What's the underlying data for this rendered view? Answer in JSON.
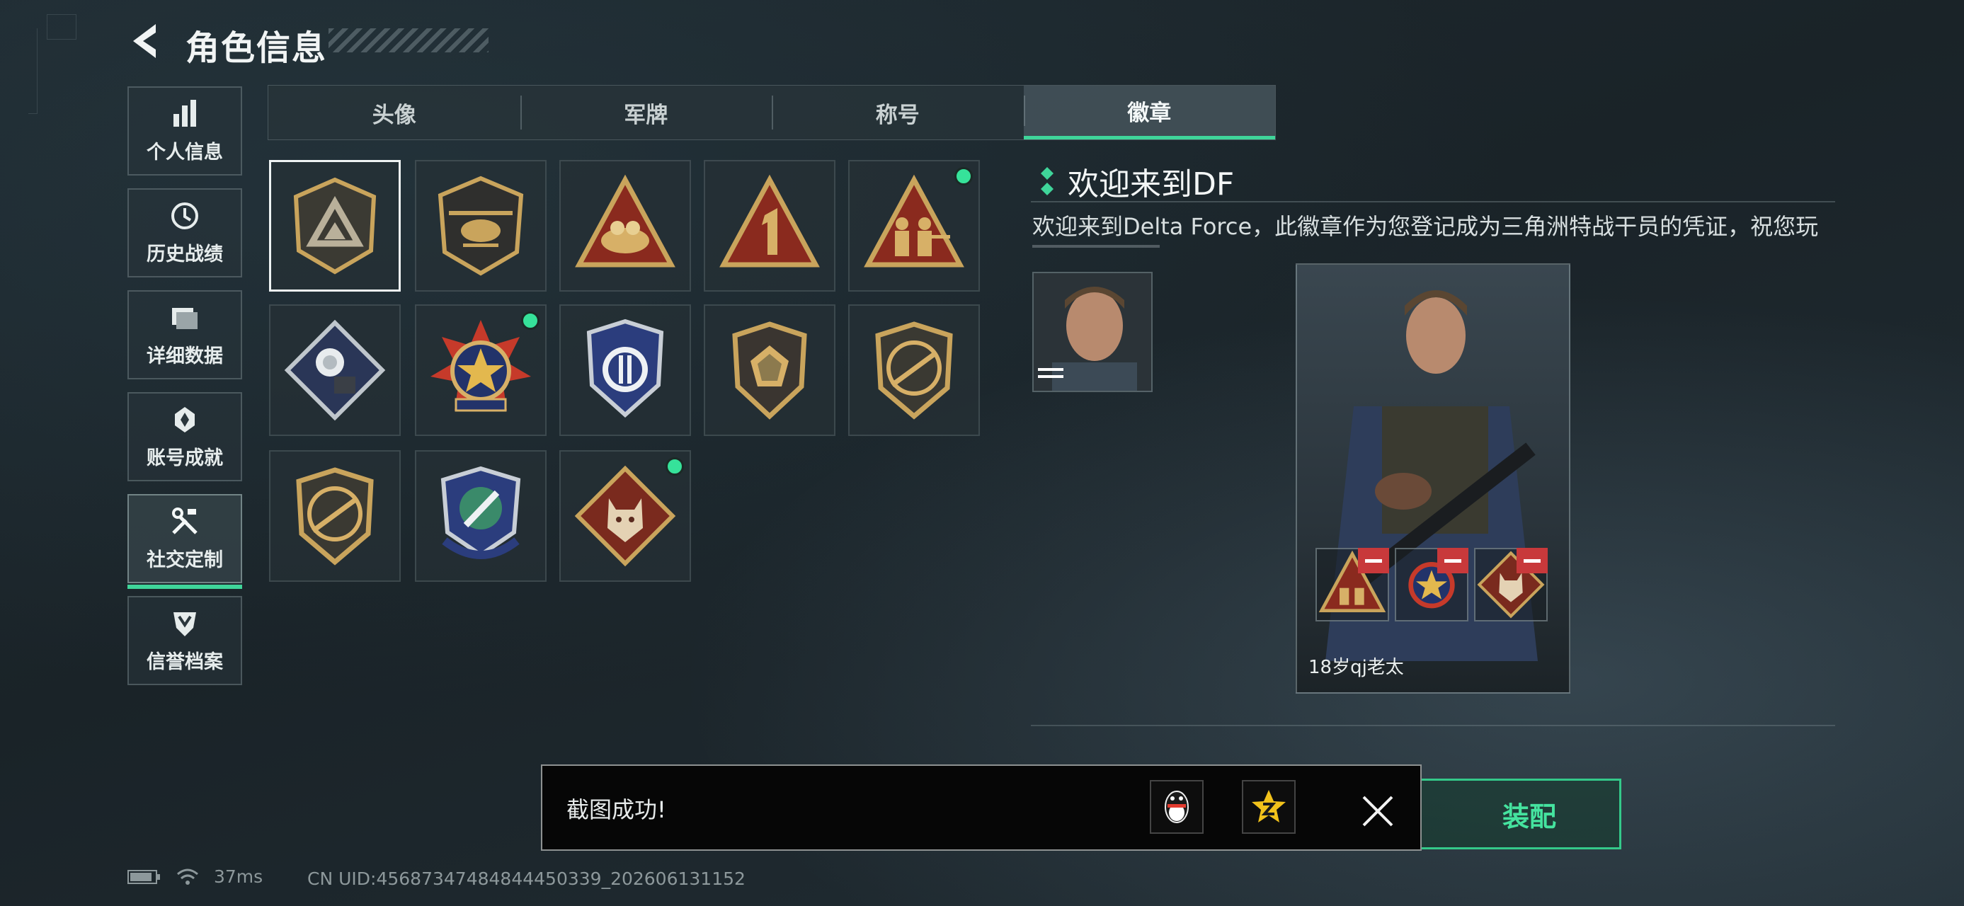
{
  "header": {
    "title": "角色信息"
  },
  "nav": [
    {
      "label": "个人信息",
      "icon": "bar-chart-icon"
    },
    {
      "label": "历史战绩",
      "icon": "history-icon"
    },
    {
      "label": "详细数据",
      "icon": "folder-icon"
    },
    {
      "label": "账号成就",
      "icon": "achievement-icon"
    },
    {
      "label": "社交定制",
      "icon": "tools-icon",
      "active": true
    },
    {
      "label": "信誉档案",
      "icon": "shield-icon"
    }
  ],
  "tabs": [
    {
      "label": "头像"
    },
    {
      "label": "军牌"
    },
    {
      "label": "称号"
    },
    {
      "label": "徽章",
      "active": true
    }
  ],
  "badges": [
    {
      "icon": "delta-shield-badge-icon",
      "selected": true,
      "new": false
    },
    {
      "icon": "helicopter-badge-icon",
      "new": false
    },
    {
      "icon": "nest-badge-icon",
      "new": false
    },
    {
      "icon": "number-one-badge-icon",
      "new": false
    },
    {
      "icon": "soldiers-badge-icon",
      "new": true
    },
    {
      "icon": "rose-badge-icon",
      "new": false
    },
    {
      "icon": "star-medal-badge-icon",
      "new": true
    },
    {
      "icon": "blue-shield-badge-icon",
      "new": false
    },
    {
      "icon": "gem-shield-badge-icon",
      "new": false
    },
    {
      "icon": "rifle-shield-badge-icon",
      "new": false
    },
    {
      "icon": "rifle-shield-badge-icon-2",
      "new": false
    },
    {
      "icon": "knife-crest-badge-icon",
      "new": false
    },
    {
      "icon": "wolf-badge-icon",
      "new": true
    }
  ],
  "detail": {
    "title": "欢迎来到DF",
    "description": "欢迎来到Delta Force，此徽章作为您登记成为三角洲特战干员的凭证，祝您玩"
  },
  "card": {
    "player_name": "18岁qj老太",
    "equipped": [
      "soldiers-badge-icon",
      "star-medal-badge-icon",
      "wolf-badge-icon"
    ]
  },
  "equip_button": {
    "label": "装配"
  },
  "toast": {
    "text": "截图成功!"
  },
  "footer": {
    "ping": "37ms",
    "uid": "CN UID:4568734748484445033​9_202606131152"
  },
  "colors": {
    "accent": "#3fd59a",
    "remove": "#c8393b",
    "gold": "#c9a45c"
  }
}
